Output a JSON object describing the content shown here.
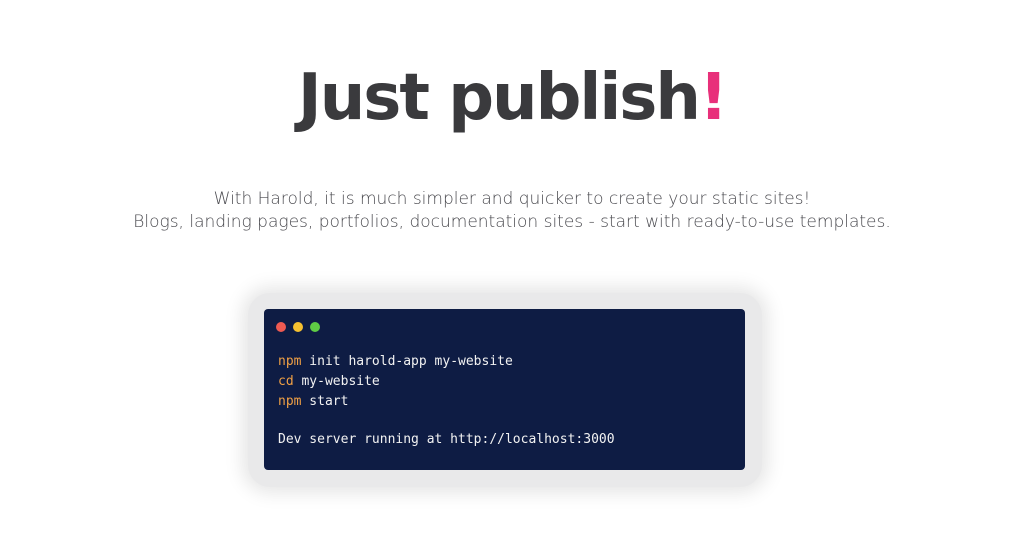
{
  "hero": {
    "title_main": "Just publish",
    "title_punct": "!",
    "accent_color": "#e8307a",
    "text_color": "#3a3a3d"
  },
  "subtitle": {
    "line1": "With Harold, it is much simpler and quicker to create your static sites!",
    "line2": "Blogs, landing pages, portfolios, documentation sites - start with ready-to-use templates."
  },
  "terminal": {
    "background": "#0e1c44",
    "window_buttons": [
      {
        "name": "close",
        "color": "#ee5a52"
      },
      {
        "name": "minimize",
        "color": "#f5c030"
      },
      {
        "name": "maximize",
        "color": "#5fcc45"
      }
    ],
    "lines": [
      {
        "cmd": "npm",
        "args": " init harold-app my-website"
      },
      {
        "cmd": "cd",
        "args": " my-website"
      },
      {
        "cmd": "npm",
        "args": " start"
      }
    ],
    "output": "Dev server running at http://localhost:3000"
  }
}
